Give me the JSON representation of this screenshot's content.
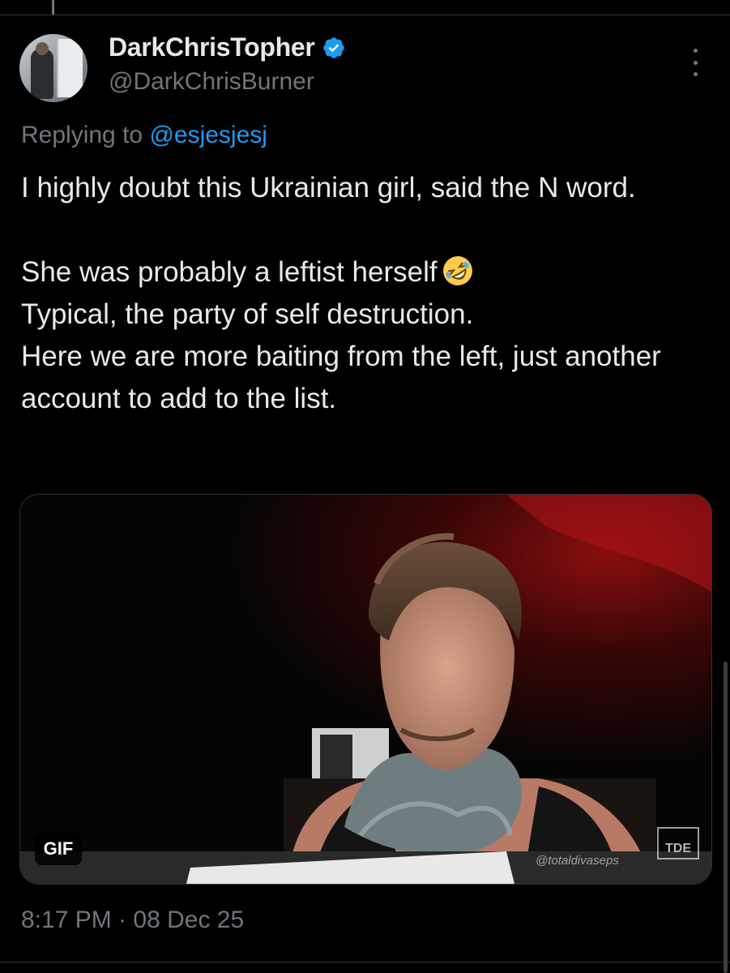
{
  "tweet": {
    "author": {
      "display_name": "DarkChrisTopher",
      "handle": "@DarkChrisBurner",
      "verified": true,
      "verified_color": "#1d9bf0"
    },
    "reply": {
      "prefix": "Replying to ",
      "mention": "@esjesjesj"
    },
    "text": {
      "line1": "I highly doubt this Ukrainian girl, said the N word.",
      "line2": "She was probably a leftist herself",
      "line2_emoji": "rolling-on-floor-laughing-emoji",
      "line3": "Typical, the party of self destruction.",
      "line4": "Here we are more baiting from the left, just another account to add to the list."
    },
    "media": {
      "badge": "GIF",
      "watermark": "@totaldivaseps",
      "logo_text": "TDE"
    },
    "timestamp": "8:17 PM · 08 Dec 25"
  },
  "colors": {
    "background": "#000000",
    "text_primary": "#e7e9ea",
    "text_secondary": "#71767b",
    "link": "#1d9bf0",
    "divider": "#2f3336"
  }
}
